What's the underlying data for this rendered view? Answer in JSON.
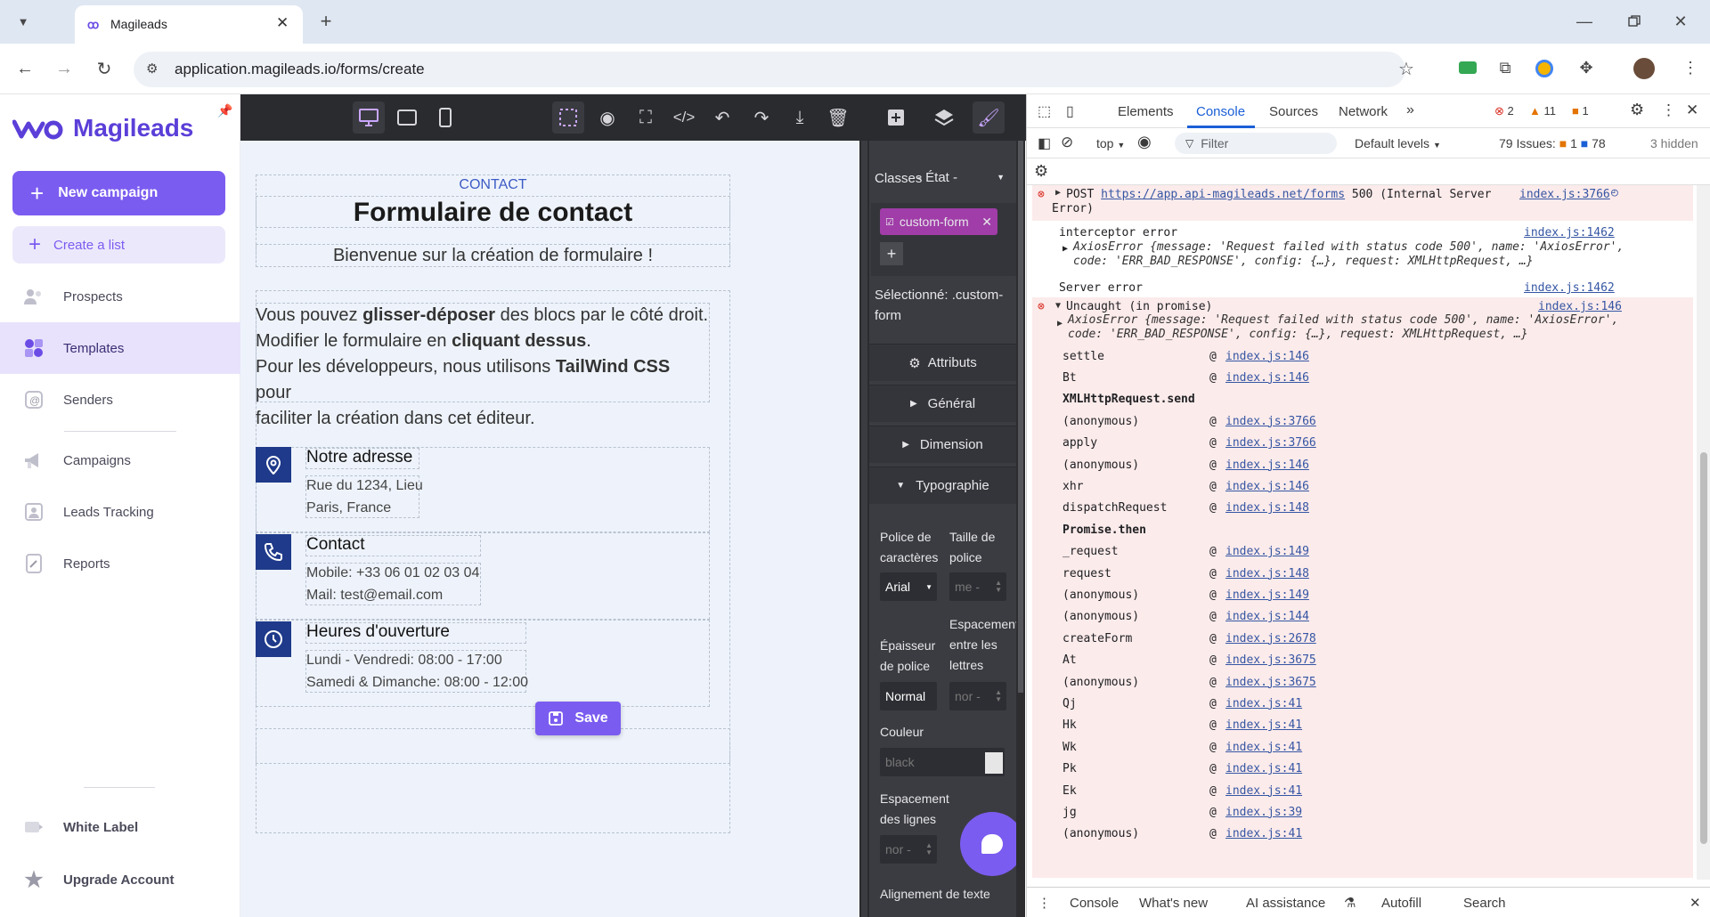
{
  "browser": {
    "tab_title": "Magileads",
    "url": "application.magileads.io/forms/create"
  },
  "sidebar": {
    "brand": "Magileads",
    "new_campaign": "New campaign",
    "create_list": "Create a list",
    "items": [
      {
        "label": "Prospects",
        "icon": "users-icon"
      },
      {
        "label": "Templates",
        "icon": "templates-icon",
        "active": true
      },
      {
        "label": "Senders",
        "icon": "senders-icon"
      },
      {
        "label": "Campaigns",
        "icon": "megaphone-icon"
      },
      {
        "label": "Leads Tracking",
        "icon": "leads-tracking-icon"
      },
      {
        "label": "Reports",
        "icon": "reports-icon"
      }
    ],
    "bottom": [
      {
        "label": "White Label",
        "icon": "white-label-icon"
      },
      {
        "label": "Upgrade Account",
        "icon": "star-icon"
      }
    ]
  },
  "form": {
    "tag": "CONTACT",
    "title": "Formulaire de contact",
    "subtitle": "Bienvenue sur la création de formulaire !",
    "intro": {
      "l1a": "Vous pouvez ",
      "l1b": "glisser-déposer",
      "l1c": " des blocs par le côté droit.",
      "l2a": "Modifier le formulaire en ",
      "l2b": "cliquant dessus",
      "l2c": ".",
      "l3a": "Pour les développeurs, nous utilisons ",
      "l3b": "TailWind CSS",
      "l3c": " pour",
      "l4": "faciliter la création dans cet éditeur."
    },
    "blocks": [
      {
        "title": "Notre adresse",
        "lines": [
          "Rue du 1234, Lieu",
          "Paris, France"
        ],
        "icon": "location-pin-icon"
      },
      {
        "title": "Contact",
        "lines": [
          "Mobile: +33 06 01 02 03 04",
          "Mail: test@email.com"
        ],
        "icon": "phone-icon"
      },
      {
        "title": "Heures d'ouverture",
        "lines": [
          "Lundi - Vendredi: 08:00 - 17:00",
          "Samedi & Dimanche: 08:00 - 12:00"
        ],
        "icon": "clock-icon"
      }
    ],
    "save": "Save"
  },
  "style_panel": {
    "classes_label": "Classes",
    "state_label": "- État -",
    "class_tag": "custom-form",
    "selected_label": "Sélectionné:",
    "selected_value": ".custom-form",
    "attributs": "Attributs",
    "general": "Général",
    "dimension": "Dimension",
    "typographie": "Typographie",
    "font_label": "Police de caractères",
    "font_value": "Arial",
    "size_label": "Taille de police",
    "size_value": "me -",
    "weight_label": "Épaisseur de police",
    "weight_value": "Normal",
    "spacing_label": "Espacement entre les lettres",
    "spacing_value": "nor -",
    "color_label": "Couleur",
    "color_value": "black",
    "line_label": "Espacement des lignes",
    "line_value": "nor -",
    "align_label": "Alignement de texte"
  },
  "devtools": {
    "tabs": [
      "Elements",
      "Console",
      "Sources",
      "Network"
    ],
    "active_tab": "Console",
    "errors": "2",
    "warnings": "11",
    "issues_badge": "1",
    "context": "top",
    "filter_placeholder": "Filter",
    "levels": "Default levels",
    "issues_label": "79 Issues:",
    "issues_err": "1",
    "issues_info": "78",
    "hidden": "3 hidden",
    "post_msg": "POST",
    "post_url": "https://app.api-magileads.net/forms",
    "post_status": "500 (Internal Server",
    "post_status2": "Error)",
    "post_src": "index.js:3766",
    "interceptor": "interceptor error",
    "interceptor_src": "index.js:1462",
    "axios1a": "AxiosError {message: 'Request failed with status code 500', name: 'AxiosError',",
    "axios1b": "code: 'ERR_BAD_RESPONSE', config: {…}, request: XMLHttpRequest, …}",
    "server_error": "Server error",
    "server_src": "index.js:1462",
    "uncaught": "Uncaught (in promise)",
    "uncaught_src": "index.js:146",
    "stack": [
      {
        "fn": "settle",
        "src": "index.js:146"
      },
      {
        "fn": "Bt",
        "src": "index.js:146"
      },
      {
        "fn": "XMLHttpRequest.send",
        "src": "",
        "bold": true
      },
      {
        "fn": "(anonymous)",
        "src": "index.js:3766"
      },
      {
        "fn": "apply",
        "src": "index.js:3766"
      },
      {
        "fn": "(anonymous)",
        "src": "index.js:146"
      },
      {
        "fn": "xhr",
        "src": "index.js:146"
      },
      {
        "fn": "dispatchRequest",
        "src": "index.js:148"
      },
      {
        "fn": "Promise.then",
        "src": "",
        "bold": true
      },
      {
        "fn": "_request",
        "src": "index.js:149"
      },
      {
        "fn": "request",
        "src": "index.js:148"
      },
      {
        "fn": "(anonymous)",
        "src": "index.js:149"
      },
      {
        "fn": "(anonymous)",
        "src": "index.js:144"
      },
      {
        "fn": "createForm",
        "src": "index.js:2678"
      },
      {
        "fn": "At",
        "src": "index.js:3675"
      },
      {
        "fn": "(anonymous)",
        "src": "index.js:3675"
      },
      {
        "fn": "Qj",
        "src": "index.js:41"
      },
      {
        "fn": "Hk",
        "src": "index.js:41"
      },
      {
        "fn": "Wk",
        "src": "index.js:41"
      },
      {
        "fn": "Pk",
        "src": "index.js:41"
      },
      {
        "fn": "Ek",
        "src": "index.js:41"
      },
      {
        "fn": "jg",
        "src": "index.js:39"
      },
      {
        "fn": "(anonymous)",
        "src": "index.js:41"
      }
    ],
    "bottom_tabs": [
      "Console",
      "What's new",
      "AI assistance",
      "Autofill",
      "Search"
    ]
  }
}
